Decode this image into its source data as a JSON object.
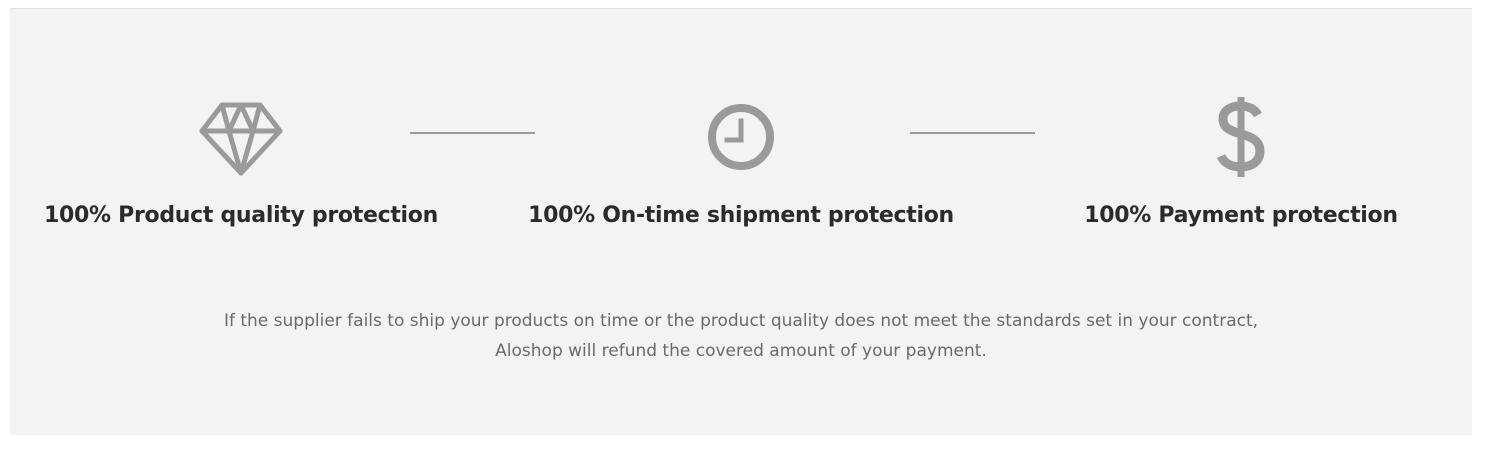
{
  "features": [
    {
      "icon": "diamond-icon",
      "title": "100% Product quality protection"
    },
    {
      "icon": "clock-icon",
      "title": "100% On-time shipment protection"
    },
    {
      "icon": "dollar-icon",
      "title": "100% Payment protection"
    }
  ],
  "description": "If the supplier fails to ship your products on time or the product quality does not meet the standards set in your contract, Aloshop will refund the covered amount of your payment.",
  "colors": {
    "background": "#f3f3f3",
    "icon": "#9a9a9a",
    "title": "#2b2b2b",
    "text": "#6a6a6a"
  }
}
